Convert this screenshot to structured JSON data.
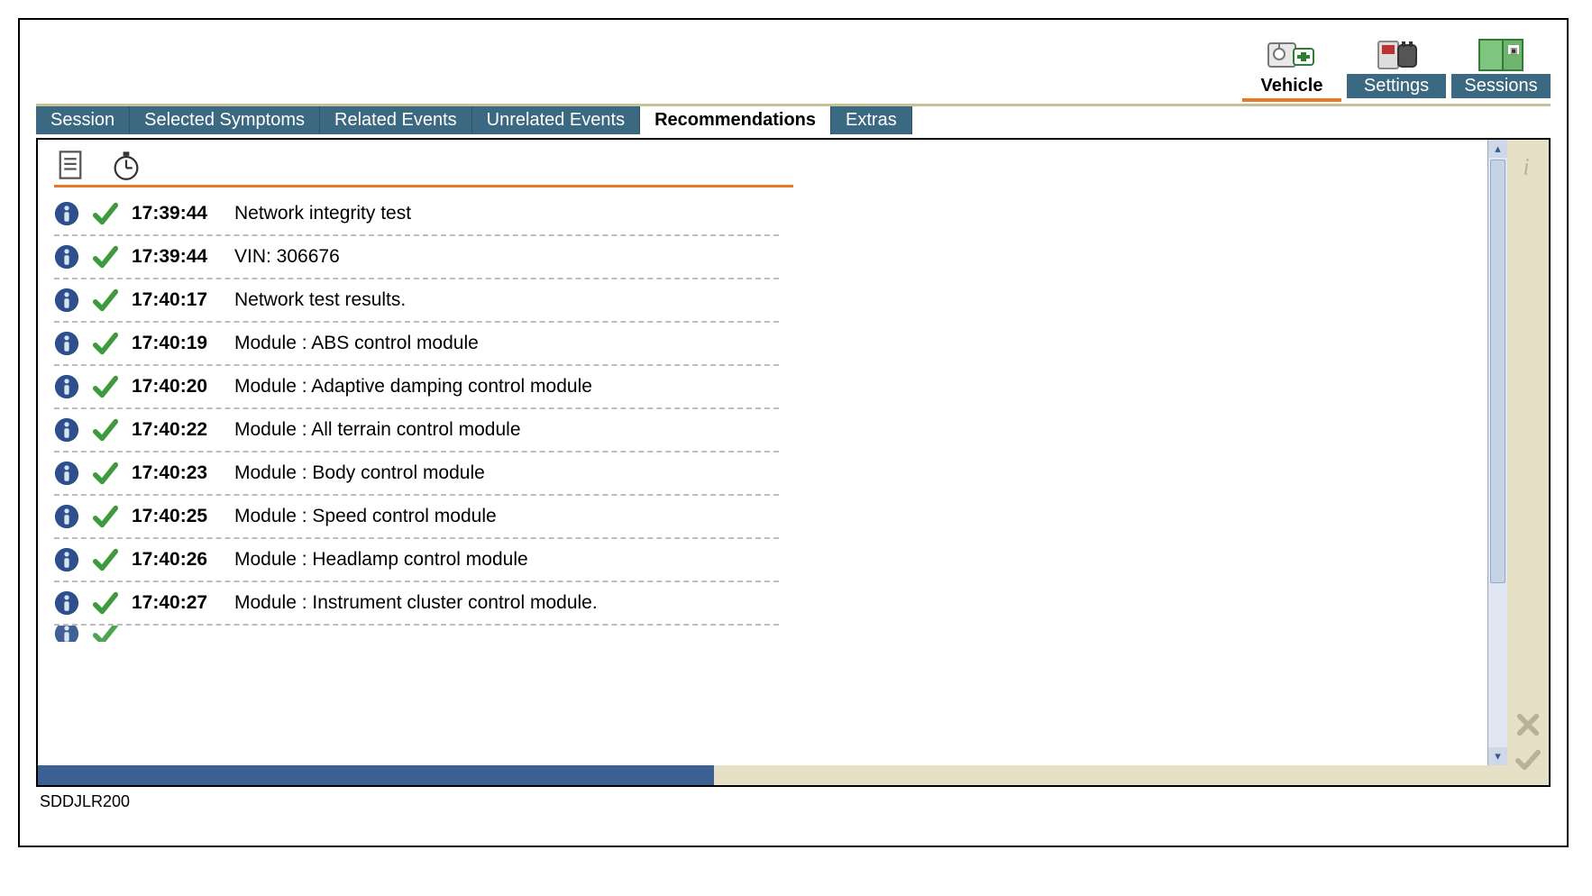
{
  "topnav": [
    {
      "key": "vehicle",
      "label": "Vehicle",
      "active": true
    },
    {
      "key": "settings",
      "label": "Settings",
      "active": false
    },
    {
      "key": "sessions",
      "label": "Sessions",
      "active": false
    }
  ],
  "tabs": [
    {
      "key": "session",
      "label": "Session",
      "active": false
    },
    {
      "key": "selected-symptoms",
      "label": "Selected Symptoms",
      "active": false
    },
    {
      "key": "related-events",
      "label": "Related Events",
      "active": false
    },
    {
      "key": "unrelated-events",
      "label": "Unrelated Events",
      "active": false
    },
    {
      "key": "recommendations",
      "label": "Recommendations",
      "active": true
    },
    {
      "key": "extras",
      "label": "Extras",
      "active": false
    }
  ],
  "rows": [
    {
      "time": "17:39:44",
      "text": "Network integrity test"
    },
    {
      "time": "17:39:44",
      "text": "VIN: 306676"
    },
    {
      "time": "17:40:17",
      "text": "Network test results."
    },
    {
      "time": "17:40:19",
      "text": "Module : ABS control module"
    },
    {
      "time": "17:40:20",
      "text": "Module : Adaptive damping control module"
    },
    {
      "time": "17:40:22",
      "text": "Module : All terrain control module"
    },
    {
      "time": "17:40:23",
      "text": "Module : Body control module"
    },
    {
      "time": "17:40:25",
      "text": "Module : Speed control module"
    },
    {
      "time": "17:40:26",
      "text": "Module : Headlamp control module"
    },
    {
      "time": "17:40:27",
      "text": "Module : Instrument cluster control module."
    }
  ],
  "footer_label": "SDDJLR200",
  "scroll": {
    "up": "▴",
    "down": "▾"
  }
}
